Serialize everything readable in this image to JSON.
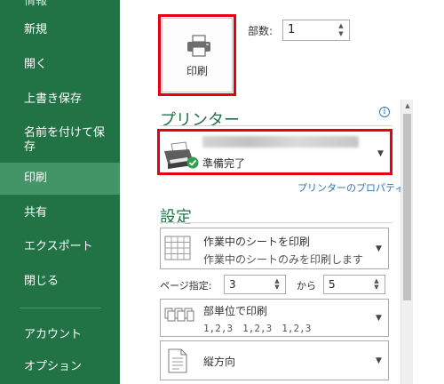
{
  "sidebar": {
    "partial_top": "情報",
    "items": [
      {
        "label": "新規"
      },
      {
        "label": "開く"
      },
      {
        "label": "上書き保存"
      },
      {
        "label": "名前を付けて保存"
      },
      {
        "label": "印刷"
      },
      {
        "label": "共有"
      },
      {
        "label": "エクスポート"
      },
      {
        "label": "閉じる"
      },
      {
        "label": "アカウント"
      },
      {
        "label": "オプション"
      }
    ],
    "selected": "印刷"
  },
  "print_button": {
    "label": "印刷",
    "icon": "printer-icon"
  },
  "copies": {
    "label": "部数:",
    "value": "1"
  },
  "printer_section": {
    "title": "プリンター",
    "status": "準備完了",
    "properties_link": "プリンターのプロパティ",
    "info_icon": "i"
  },
  "settings_section": {
    "title": "設定",
    "print_what": {
      "title": "作業中のシートを印刷",
      "subtitle": "作業中のシートのみを印刷します"
    },
    "pages": {
      "label": "ページ指定:",
      "from": "3",
      "to_label": "から",
      "to": "5"
    },
    "collation": {
      "title": "部単位で印刷",
      "subtitle": "1,2,3　1,2,3　1,2,3"
    },
    "orientation": {
      "title": "縦方向"
    }
  },
  "colors": {
    "sidebar_bg": "#217346",
    "sidebar_selected": "#439467",
    "accent_green": "#217346",
    "highlight_red": "#e60012",
    "link_blue": "#2e75b6"
  }
}
